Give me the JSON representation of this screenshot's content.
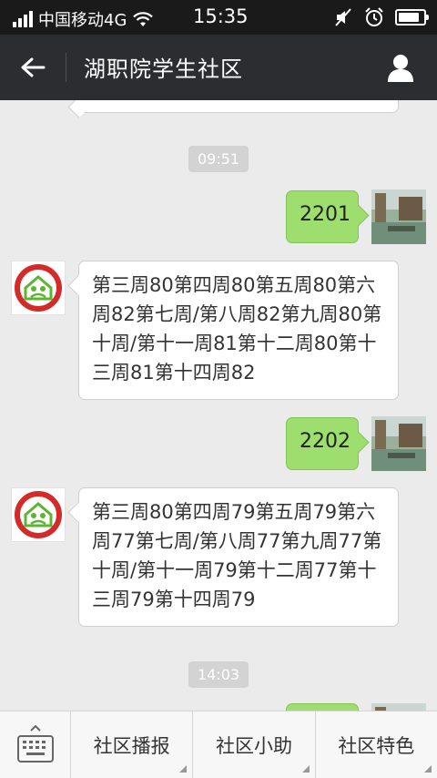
{
  "status_bar": {
    "carrier": "中国移动4G",
    "time": "15:35",
    "battery_level": 0.85
  },
  "header": {
    "title": "湖职院学生社区"
  },
  "messages": {
    "time_1": "09:51",
    "time_2": "14:03",
    "out_1": "2201",
    "in_1": "第三周80第四周80第五周80第六周82第七周/第八周82第九周80第十周/第十一周81第十二周80第十三周81第十四周82",
    "out_2": "2202",
    "in_2": "第三周80第四周79第五周79第六周77第七周/第八周77第九周77第十周/第十一周79第十二周77第十三周79第十四周79"
  },
  "bottom_menu": {
    "items": [
      "社区播报",
      "社区小助",
      "社区特色"
    ]
  },
  "colors": {
    "header_bg": "#2c2d31",
    "status_bg": "#1a1a1a",
    "chat_bg": "#ebebeb",
    "out_bubble": "#9ede6f",
    "logo_red": "#d42a2a",
    "logo_green": "#5cb531"
  }
}
